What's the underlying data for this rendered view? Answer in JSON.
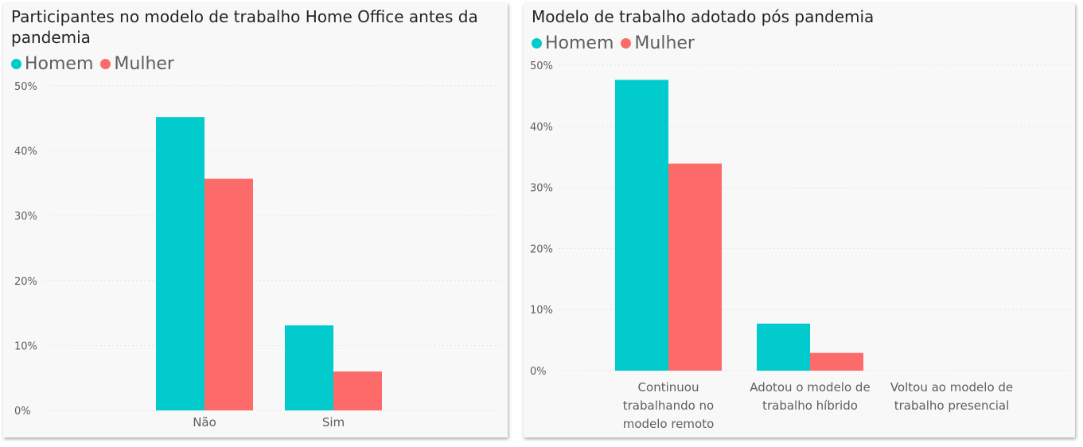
{
  "chart_data": [
    {
      "type": "bar",
      "title": "Participantes no modelo de trabalho Home Office antes da pandemia",
      "categories": [
        "Não",
        "Sim"
      ],
      "series": [
        {
          "name": "Homem",
          "values": [
            45.2,
            13.1
          ]
        },
        {
          "name": "Mulher",
          "values": [
            35.7,
            6.0
          ]
        }
      ],
      "ylim": [
        0,
        50
      ],
      "yticks": [
        "0%",
        "10%",
        "20%",
        "30%",
        "40%",
        "50%"
      ],
      "ytick_values": [
        0,
        10,
        20,
        30,
        40,
        50
      ],
      "grid": true,
      "legend_position": "top-left"
    },
    {
      "type": "bar",
      "title": "Modelo de trabalho adotado pós pandemia",
      "categories": [
        "Continuou trabalhando no modelo remoto",
        "Adotou o modelo de trabalho híbrido",
        "Voltou ao modelo de trabalho presencial"
      ],
      "series": [
        {
          "name": "Homem",
          "values": [
            47.6,
            7.7
          ]
        },
        {
          "name": "Mulher",
          "values": [
            33.9,
            2.9
          ]
        }
      ],
      "ylim": [
        0,
        50
      ],
      "yticks": [
        "0%",
        "10%",
        "20%",
        "30%",
        "40%",
        "50%"
      ],
      "ytick_values": [
        0,
        10,
        20,
        30,
        40,
        50
      ],
      "grid": true,
      "legend_position": "top-left"
    }
  ],
  "colors": {
    "homem": "#01cbcc",
    "mulher": "#fd6a6a"
  }
}
